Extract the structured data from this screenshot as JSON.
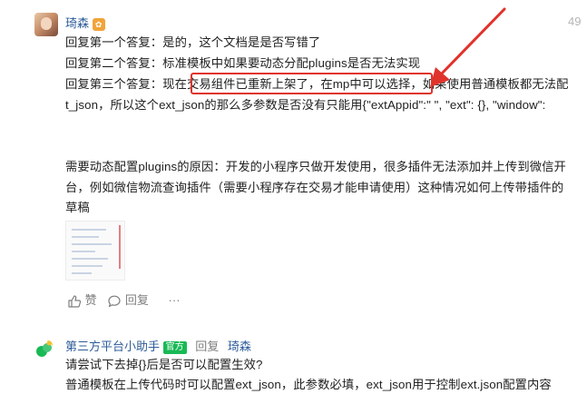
{
  "comment": {
    "author": "琦森",
    "badge": "✿",
    "time": "49",
    "lines": [
      "回复第一个答复：是的，这个文档是是否写错了",
      "回复第二个答复：标准模板中如果要动态分配plugins是否无法实现",
      "回复第三个答复：现在交易组件已重新上架了，在mp中可以选择，如果使用普通模板都无法配",
      "t_json，所以这个ext_json的那么多参数是否没有只能用{\"extAppid\":\" \", \"ext\": {}, \"window\":",
      "需要动态配置plugins的原因：开发的小程序只做开发使用，很多插件无法添加并上传到微信开",
      "台，例如微信物流查询插件（需要小程序存在交易才能申请使用）这种情况如何上传带插件的",
      "草稿"
    ],
    "actions": {
      "like_label": "赞",
      "reply_label": "回复",
      "more_label": "···"
    }
  },
  "reply": {
    "author": "第三方平台小助手",
    "official_badge": "官方",
    "reply_word": "回复",
    "reply_to": "琦森",
    "lines": [
      "请尝试下去掉{}后是否可以配置生效?",
      "普通模板在上传代码时可以配置ext_json，此参数必填，ext_json用于控制ext.json配置内容"
    ]
  },
  "colors": {
    "link": "#2e5c9a",
    "annotation_red": "#e0332c",
    "official_green": "#19b955",
    "badge_orange": "#f0a43b"
  }
}
